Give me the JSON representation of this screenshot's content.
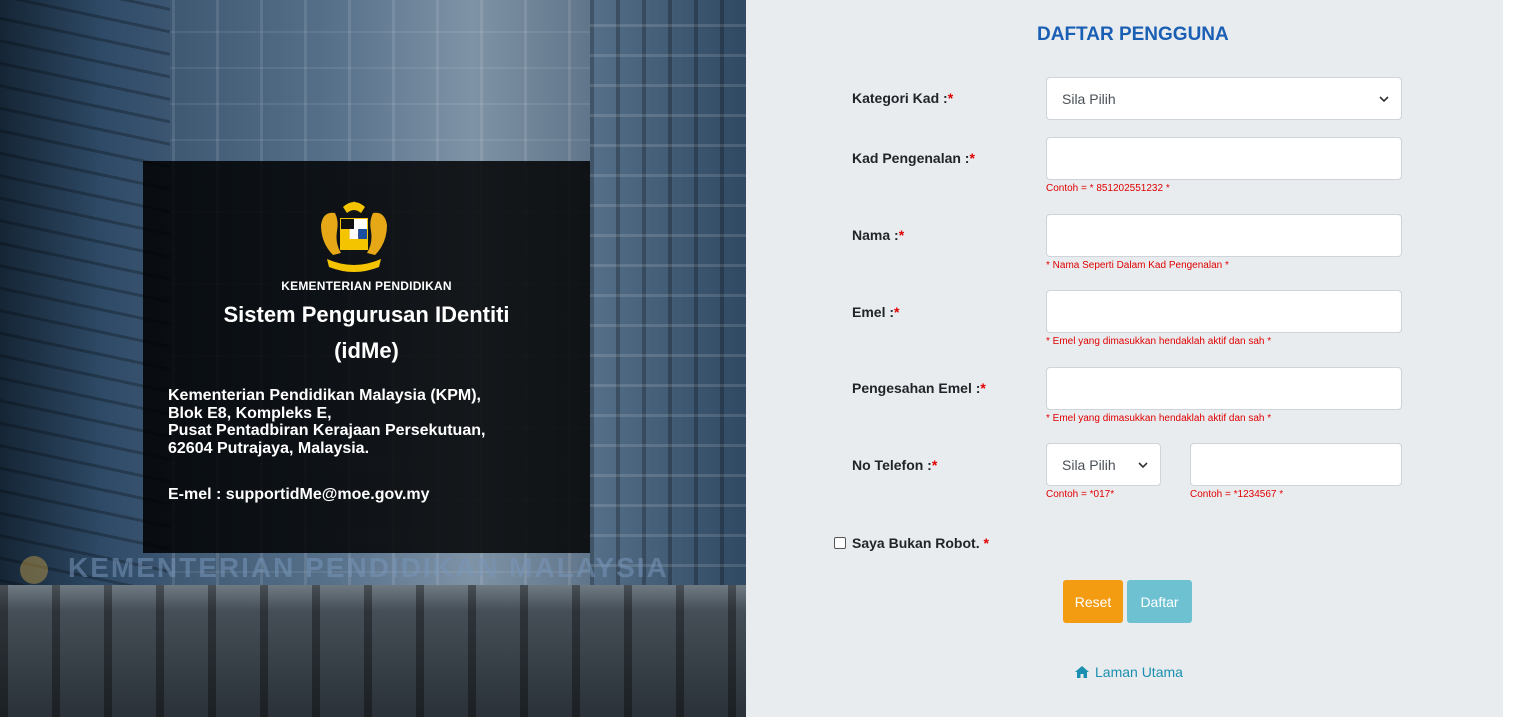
{
  "left": {
    "ministry": "KEMENTERIAN PENDIDIKAN",
    "system_title_line1": "Sistem Pengurusan IDentiti",
    "system_title_line2": "(idMe)",
    "address_lines": [
      "Kementerian Pendidikan Malaysia (KPM),",
      "Blok E8, Kompleks E,",
      "Pusat Pentadbiran Kerajaan Persekutuan,",
      "62604 Putrajaya, Malaysia."
    ],
    "email": "E-mel : supportidMe@moe.gov.my",
    "building_sign": "KEMENTERIAN PENDIDIKAN MALAYSIA"
  },
  "form": {
    "title": "DAFTAR PENGGUNA",
    "required_mark": "*",
    "fields": {
      "kategori": {
        "label": "Kategori Kad :",
        "selected": "Sila Pilih"
      },
      "ic": {
        "label": "Kad Pengenalan :",
        "value": "",
        "hint": "Contoh = * 851202551232 *"
      },
      "nama": {
        "label": "Nama :",
        "value": "",
        "hint": "* Nama Seperti Dalam Kad Pengenalan *"
      },
      "emel": {
        "label": "Emel :",
        "value": "",
        "hint": "* Emel yang dimasukkan hendaklah aktif dan sah *"
      },
      "pengesahan": {
        "label": "Pengesahan Emel :",
        "value": "",
        "hint": "* Emel yang dimasukkan hendaklah aktif dan sah *"
      },
      "telefon": {
        "label": "No Telefon :",
        "prefix_selected": "Sila Pilih",
        "prefix_hint": "Contoh = *017*",
        "number_value": "",
        "number_hint": "Contoh = *1234567 *"
      }
    },
    "robot_label": "Saya Bukan Robot.",
    "reset_label": "Reset",
    "submit_label": "Daftar",
    "home_link": "Laman Utama"
  }
}
